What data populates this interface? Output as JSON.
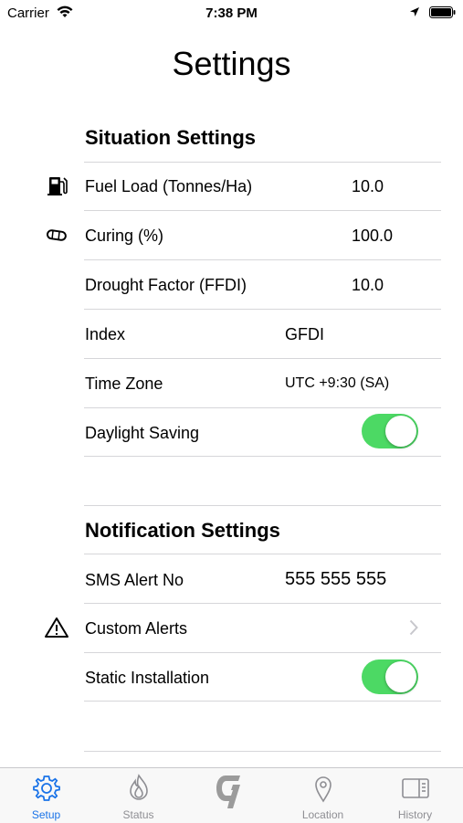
{
  "status_bar": {
    "carrier": "Carrier",
    "time": "7:38 PM"
  },
  "page": {
    "title": "Settings"
  },
  "situation": {
    "header": "Situation Settings",
    "fuel_load": {
      "label": "Fuel Load (Tonnes/Ha)",
      "value": "10.0",
      "icon": "fuel-pump-icon"
    },
    "curing": {
      "label": "Curing (%)",
      "value": "100.0",
      "icon": "hay-bale-icon"
    },
    "drought_factor": {
      "label": "Drought Factor (FFDI)",
      "value": "10.0"
    },
    "index": {
      "label": "Index",
      "value": "GFDI"
    },
    "time_zone": {
      "label": "Time Zone",
      "value": "UTC +9:30 (SA)"
    },
    "daylight_saving": {
      "label": "Daylight Saving",
      "on": true
    }
  },
  "notification": {
    "header": "Notification Settings",
    "sms_alert": {
      "label": "SMS Alert No",
      "value": "555 555 555"
    },
    "custom_alerts": {
      "label": "Custom Alerts",
      "icon": "warning-icon"
    },
    "static_installation": {
      "label": "Static Installation",
      "on": true
    }
  },
  "tabs": [
    {
      "label": "Setup",
      "icon": "gear-icon",
      "active": true
    },
    {
      "label": "Status",
      "icon": "flame-icon",
      "active": false
    },
    {
      "label": "",
      "icon": "logo-icon",
      "active": false
    },
    {
      "label": "Location",
      "icon": "map-pin-icon",
      "active": false
    },
    {
      "label": "History",
      "icon": "history-icon",
      "active": false
    }
  ],
  "colors": {
    "toggle_on": "#4cd964",
    "tab_active": "#1a73e8",
    "tab_inactive": "#8e8e93"
  }
}
